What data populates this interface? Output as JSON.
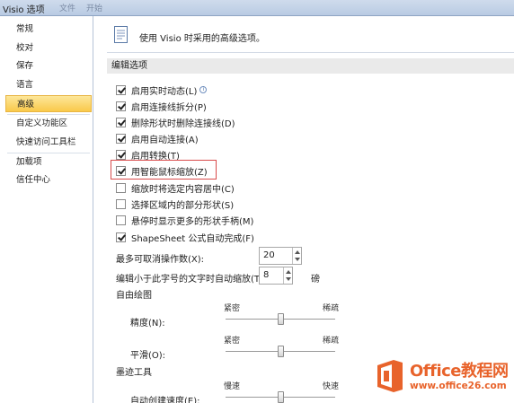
{
  "window": {
    "title": "Visio 选项",
    "ghost_tabs": [
      "文件",
      "开始"
    ]
  },
  "sidebar": {
    "items": [
      {
        "label": "常规"
      },
      {
        "label": "校对"
      },
      {
        "label": "保存"
      },
      {
        "label": "语言"
      },
      {
        "label": "高级",
        "selected": true
      },
      {
        "label": "自定义功能区"
      },
      {
        "label": "快速访问工具栏"
      },
      {
        "label": "加载项"
      },
      {
        "label": "信任中心"
      }
    ]
  },
  "header": {
    "icon": "options-page-icon",
    "text": "使用 Visio 时采用的高级选项。"
  },
  "editing": {
    "title": "编辑选项",
    "options": [
      {
        "label": "启用实时动态(L)",
        "checked": true,
        "info": true
      },
      {
        "label": "启用连接线拆分(P)",
        "checked": true
      },
      {
        "label": "删除形状时删除连接线(D)",
        "checked": true
      },
      {
        "label": "启用自动连接(A)",
        "checked": true
      },
      {
        "label": "启用转换(T)",
        "checked": true
      },
      {
        "label": "用智能鼠标缩放(Z)",
        "checked": true,
        "highlighted": true
      },
      {
        "label": "缩放时将选定内容居中(C)",
        "checked": false
      },
      {
        "label": "选择区域内的部分形状(S)",
        "checked": false
      },
      {
        "label": "悬停时显示更多的形状手柄(M)",
        "checked": false
      },
      {
        "label": "ShapeSheet 公式自动完成(F)",
        "checked": true
      }
    ],
    "undo_label": "最多可取消操作数(X):",
    "undo_value": "20",
    "zoom_text_label": "编辑小于此字号的文字时自动缩放(T):",
    "zoom_text_value": "8",
    "zoom_text_unit": "磅"
  },
  "freeform": {
    "title": "自由绘图",
    "precision": {
      "label": "精度(N):",
      "left": "紧密",
      "right": "稀疏",
      "level": 0.5
    },
    "smoothing": {
      "label": "平滑(O):",
      "left": "紧密",
      "right": "稀疏",
      "level": 0.5
    }
  },
  "ink": {
    "title": "墨迹工具",
    "auto_create": {
      "label": "自动创建速度(E):",
      "left": "慢速",
      "right": "快速",
      "level": 0.5
    }
  },
  "watermark": {
    "line1": "Office教程网",
    "line2": "www.office26.com"
  },
  "colors": {
    "selected_bg": "#f9c94b",
    "highlight_border": "#d94b4b",
    "logo": "#e8632b"
  }
}
